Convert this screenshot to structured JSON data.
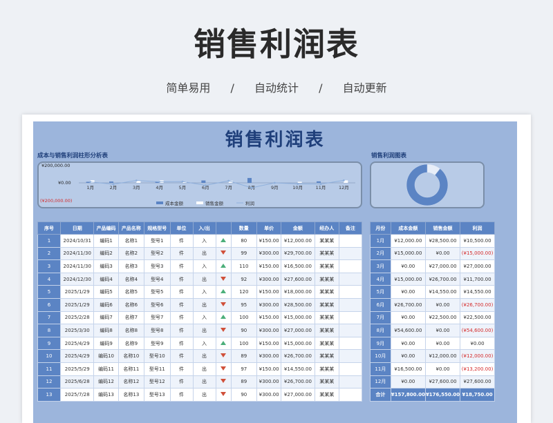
{
  "hero": {
    "title": "销售利润表",
    "tags": [
      "简单易用",
      "自动统计",
      "自动更新"
    ],
    "separator": "/"
  },
  "sheet": {
    "title": "销售利润表",
    "bar_chart_label": "成本与销售利润柱形分析表",
    "pie_chart_label": "销售利润图表"
  },
  "colors": {
    "header_blue": "#5b84c4",
    "panel_blue": "#9cb5dc",
    "title_navy": "#1f3f7a",
    "negative_red": "#d42a2a",
    "up_green": "#4caf7a",
    "down_red": "#d0503a"
  },
  "chart_data": [
    {
      "type": "bar",
      "title": "",
      "categories": [
        "1月",
        "2月",
        "3月",
        "4月",
        "5月",
        "6月",
        "7月",
        "8月",
        "9月",
        "10月",
        "11月",
        "12月"
      ],
      "y_tick_labels": [
        "¥200,000.00",
        "¥0.00",
        "(¥200,000.00)"
      ],
      "ylim": [
        -200000,
        200000
      ],
      "series": [
        {
          "name": "成本金额",
          "values": [
            12000,
            15000,
            0,
            15000,
            0,
            26700,
            0,
            54600,
            0,
            0,
            16500,
            0
          ],
          "color": "#5b84c4"
        },
        {
          "name": "销售金额",
          "values": [
            28500,
            0,
            27000,
            26700,
            14550,
            0,
            22500,
            0,
            0,
            12000,
            0,
            27600
          ],
          "color": "#ffffff"
        },
        {
          "name": "利润",
          "values": [
            10500,
            -15000,
            27000,
            11700,
            14550,
            -26700,
            22500,
            -54600,
            0,
            -12000,
            -13200,
            27600
          ],
          "color": "#8fb0dc"
        }
      ],
      "legend": "bottom"
    },
    {
      "type": "pie",
      "title": "",
      "slices": [
        {
          "name": "利润",
          "value": 18750,
          "color": "#e8eef8"
        },
        {
          "name": "成本金额",
          "value": 157800,
          "color": "#5b84c4"
        }
      ],
      "donut": true
    }
  ],
  "main_table": {
    "headers": [
      "序号",
      "日期",
      "产品编码",
      "产品名称",
      "规格型号",
      "单位",
      "入/出",
      "",
      "数量",
      "单价",
      "金额",
      "经办人",
      "备注"
    ],
    "rows": [
      {
        "idx": "1",
        "date": "2024/10/31",
        "code": "编码1",
        "name": "名称1",
        "spec": "型号1",
        "unit": "件",
        "io": "入",
        "dir": "up",
        "qty": "80",
        "price": "¥150.00",
        "amount": "¥12,000.00",
        "handler": "某某某",
        "note": ""
      },
      {
        "idx": "2",
        "date": "2024/11/30",
        "code": "编码2",
        "name": "名称2",
        "spec": "型号2",
        "unit": "件",
        "io": "出",
        "dir": "down",
        "qty": "99",
        "price": "¥300.00",
        "amount": "¥29,700.00",
        "handler": "某某某",
        "note": ""
      },
      {
        "idx": "3",
        "date": "2024/11/30",
        "code": "编码3",
        "name": "名称3",
        "spec": "型号3",
        "unit": "件",
        "io": "入",
        "dir": "up",
        "qty": "110",
        "price": "¥150.00",
        "amount": "¥16,500.00",
        "handler": "某某某",
        "note": ""
      },
      {
        "idx": "4",
        "date": "2024/12/30",
        "code": "编码4",
        "name": "名称4",
        "spec": "型号4",
        "unit": "件",
        "io": "出",
        "dir": "down",
        "qty": "92",
        "price": "¥300.00",
        "amount": "¥27,600.00",
        "handler": "某某某",
        "note": ""
      },
      {
        "idx": "5",
        "date": "2025/1/29",
        "code": "编码5",
        "name": "名称5",
        "spec": "型号5",
        "unit": "件",
        "io": "入",
        "dir": "up",
        "qty": "120",
        "price": "¥150.00",
        "amount": "¥18,000.00",
        "handler": "某某某",
        "note": ""
      },
      {
        "idx": "6",
        "date": "2025/1/29",
        "code": "编码6",
        "name": "名称6",
        "spec": "型号6",
        "unit": "件",
        "io": "出",
        "dir": "down",
        "qty": "95",
        "price": "¥300.00",
        "amount": "¥28,500.00",
        "handler": "某某某",
        "note": ""
      },
      {
        "idx": "7",
        "date": "2025/2/28",
        "code": "编码7",
        "name": "名称7",
        "spec": "型号7",
        "unit": "件",
        "io": "入",
        "dir": "up",
        "qty": "100",
        "price": "¥150.00",
        "amount": "¥15,000.00",
        "handler": "某某某",
        "note": ""
      },
      {
        "idx": "8",
        "date": "2025/3/30",
        "code": "编码8",
        "name": "名称8",
        "spec": "型号8",
        "unit": "件",
        "io": "出",
        "dir": "down",
        "qty": "90",
        "price": "¥300.00",
        "amount": "¥27,000.00",
        "handler": "某某某",
        "note": ""
      },
      {
        "idx": "9",
        "date": "2025/4/29",
        "code": "编码9",
        "name": "名称9",
        "spec": "型号9",
        "unit": "件",
        "io": "入",
        "dir": "up",
        "qty": "100",
        "price": "¥150.00",
        "amount": "¥15,000.00",
        "handler": "某某某",
        "note": ""
      },
      {
        "idx": "10",
        "date": "2025/4/29",
        "code": "编码10",
        "name": "名称10",
        "spec": "型号10",
        "unit": "件",
        "io": "出",
        "dir": "down",
        "qty": "89",
        "price": "¥300.00",
        "amount": "¥26,700.00",
        "handler": "某某某",
        "note": ""
      },
      {
        "idx": "11",
        "date": "2025/5/29",
        "code": "编码11",
        "name": "名称11",
        "spec": "型号11",
        "unit": "件",
        "io": "出",
        "dir": "down",
        "qty": "97",
        "price": "¥150.00",
        "amount": "¥14,550.00",
        "handler": "某某某",
        "note": ""
      },
      {
        "idx": "12",
        "date": "2025/6/28",
        "code": "编码12",
        "name": "名称12",
        "spec": "型号12",
        "unit": "件",
        "io": "出",
        "dir": "down",
        "qty": "89",
        "price": "¥300.00",
        "amount": "¥26,700.00",
        "handler": "某某某",
        "note": ""
      },
      {
        "idx": "13",
        "date": "2025/7/28",
        "code": "编码13",
        "name": "名称13",
        "spec": "型号13",
        "unit": "件",
        "io": "出",
        "dir": "down",
        "qty": "90",
        "price": "¥300.00",
        "amount": "¥27,000.00",
        "handler": "某某某",
        "note": ""
      }
    ]
  },
  "side_table": {
    "headers": [
      "月份",
      "成本金额",
      "销售金额",
      "利润"
    ],
    "rows": [
      {
        "month": "1月",
        "cost": "¥12,000.00",
        "sales": "¥28,500.00",
        "profit": "¥10,500.00",
        "neg": false
      },
      {
        "month": "2月",
        "cost": "¥15,000.00",
        "sales": "¥0.00",
        "profit": "(¥15,000.00)",
        "neg": true
      },
      {
        "month": "3月",
        "cost": "¥0.00",
        "sales": "¥27,000.00",
        "profit": "¥27,000.00",
        "neg": false
      },
      {
        "month": "4月",
        "cost": "¥15,000.00",
        "sales": "¥26,700.00",
        "profit": "¥11,700.00",
        "neg": false
      },
      {
        "month": "5月",
        "cost": "¥0.00",
        "sales": "¥14,550.00",
        "profit": "¥14,550.00",
        "neg": false
      },
      {
        "month": "6月",
        "cost": "¥26,700.00",
        "sales": "¥0.00",
        "profit": "(¥26,700.00)",
        "neg": true
      },
      {
        "month": "7月",
        "cost": "¥0.00",
        "sales": "¥22,500.00",
        "profit": "¥22,500.00",
        "neg": false
      },
      {
        "month": "8月",
        "cost": "¥54,600.00",
        "sales": "¥0.00",
        "profit": "(¥54,600.00)",
        "neg": true
      },
      {
        "month": "9月",
        "cost": "¥0.00",
        "sales": "¥0.00",
        "profit": "¥0.00",
        "neg": false
      },
      {
        "month": "10月",
        "cost": "¥0.00",
        "sales": "¥12,000.00",
        "profit": "(¥12,000.00)",
        "neg": true
      },
      {
        "month": "11月",
        "cost": "¥16,500.00",
        "sales": "¥0.00",
        "profit": "(¥13,200.00)",
        "neg": true
      },
      {
        "month": "12月",
        "cost": "¥0.00",
        "sales": "¥27,600.00",
        "profit": "¥27,600.00",
        "neg": false
      }
    ],
    "total": {
      "label": "合计",
      "cost": "¥157,800.00",
      "sales": "¥176,550.00",
      "profit": "¥18,750.00"
    }
  }
}
